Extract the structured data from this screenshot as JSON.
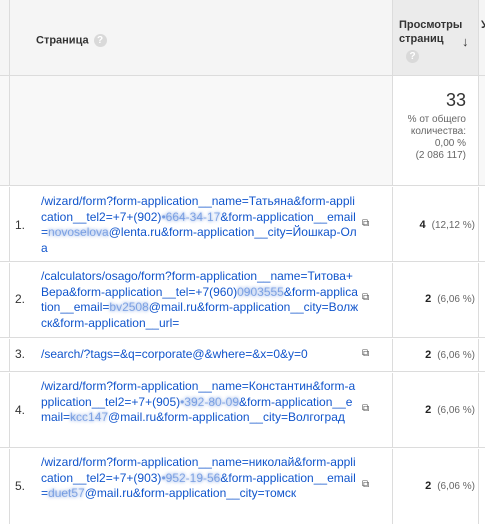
{
  "header": {
    "page_col": "Страница",
    "help_icon": "?",
    "views_col_line1": "Просмотры",
    "views_col_line2": "страниц",
    "sort_icon": "↓",
    "extra_col_cut": "У"
  },
  "totals": {
    "value": "33",
    "line1": "% от общего",
    "line2": "количества:",
    "line3": "0,00 %",
    "line4": "(2 086 117)"
  },
  "rows": [
    {
      "index": "1.",
      "url_a": "/wizard/form?form-application__name=Татьяна&form-application__tel2=+7+(902)",
      "url_blur1": "•664-34-17",
      "url_b": "&form-application__email=",
      "url_blur2": "novoselova",
      "url_c": "@lenta.ru&form-application__city=Йошкар-Ола",
      "views": "4",
      "percent": "(12,12 %)"
    },
    {
      "index": "2.",
      "url_a": "/calculators/osago/form?form-application__name=Титова+Вера&form-application__tel=+7(960)",
      "url_blur1": "0903555",
      "url_b": "&form-application__email=",
      "url_blur2": "bv2508",
      "url_c": "@mail.ru&form-application__city=Волжск&form-application__url=",
      "views": "2",
      "percent": "(6,06 %)"
    },
    {
      "index": "3.",
      "url_a": "/search/?tags=&q=corporate@&where=&x=0&y=0",
      "url_blur1": "",
      "url_b": "",
      "url_blur2": "",
      "url_c": "",
      "views": "2",
      "percent": "(6,06 %)"
    },
    {
      "index": "4.",
      "url_a": "/wizard/form?form-application__name=Константин&form-application__tel2=+7+(905)",
      "url_blur1": "•392-80-09",
      "url_b": "&form-application__email=",
      "url_blur2": "kcc147",
      "url_c": "@mail.ru&form-application__city=Волгоград",
      "views": "2",
      "percent": "(6,06 %)"
    },
    {
      "index": "5.",
      "url_a": "/wizard/form?form-application__name=николай&form-application__tel2=+7+(903)",
      "url_blur1": "•952-19-56",
      "url_b": "&form-application__email=",
      "url_blur2": "duet57",
      "url_c": "@mail.ru&form-application__city=томск",
      "views": "2",
      "percent": "(6,06 %)"
    }
  ]
}
